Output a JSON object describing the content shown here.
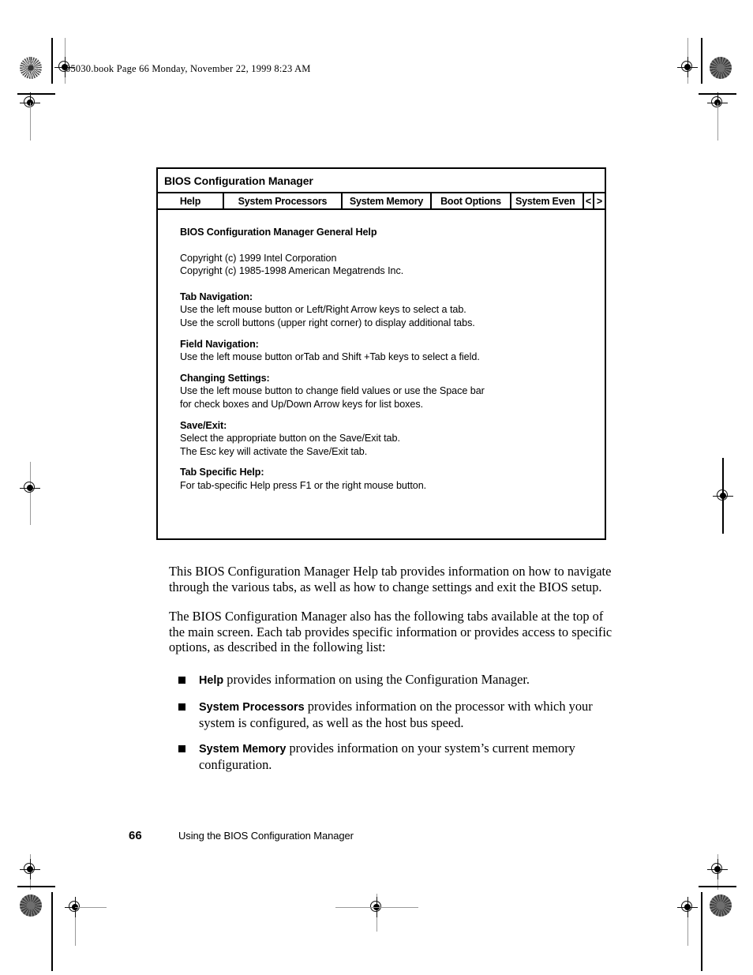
{
  "page": {
    "running_header": "05030.book  Page 66  Monday, November 22, 1999  8:23 AM",
    "footer_page_number": "66",
    "footer_title": "Using the BIOS Configuration Manager"
  },
  "bios_screen": {
    "title": "BIOS Configuration Manager",
    "tabs": [
      {
        "label": "Help",
        "active": true
      },
      {
        "label": "System Processors",
        "active": false
      },
      {
        "label": "System Memory",
        "active": false
      },
      {
        "label": "Boot Options",
        "active": false
      },
      {
        "label": "System Even",
        "active": false
      }
    ],
    "scroll_left_label": "<",
    "scroll_right_label": ">",
    "body_heading": "BIOS Configuration Manager General Help",
    "copyright": [
      "Copyright (c) 1999 Intel Corporation",
      "Copyright (c) 1985-1998 American Megatrends Inc."
    ],
    "sections": [
      {
        "heading": "Tab Navigation:",
        "lines": [
          "Use the left mouse button or Left/Right Arrow keys to select a tab.",
          "Use the scroll buttons (upper right corner) to display additional tabs."
        ]
      },
      {
        "heading": "Field Navigation:",
        "lines": [
          "Use the left mouse button orTab and Shift +Tab keys to select a field."
        ]
      },
      {
        "heading": "Changing Settings:",
        "lines": [
          "Use the left mouse button to change field values or use the Space bar",
          "for check boxes and Up/Down Arrow keys for list boxes."
        ]
      },
      {
        "heading": "Save/Exit:",
        "lines": [
          "Select the appropriate button on the Save/Exit tab.",
          "The Esc key will activate the Save/Exit tab."
        ]
      },
      {
        "heading": "Tab Specific Help:",
        "lines": [
          "For tab-specific Help press F1 or the right mouse button."
        ]
      }
    ]
  },
  "body": {
    "paragraph_1": "This BIOS Configuration Manager Help tab provides information on how to navigate through the various tabs, as well as how to change settings and exit the BIOS setup.",
    "paragraph_2": "The BIOS Configuration Manager also has the following tabs available at the top of the main screen. Each tab provides specific information or provides access to specific options, as described in the following list:",
    "bullets": [
      {
        "label": "Help",
        "text": " provides information on using the Configuration Manager."
      },
      {
        "label": "System Processors",
        "text": " provides information on the processor with which your system is configured, as well as the host bus speed."
      },
      {
        "label": "System Memory",
        "text": " provides information on your system’s current memory configuration."
      }
    ]
  }
}
